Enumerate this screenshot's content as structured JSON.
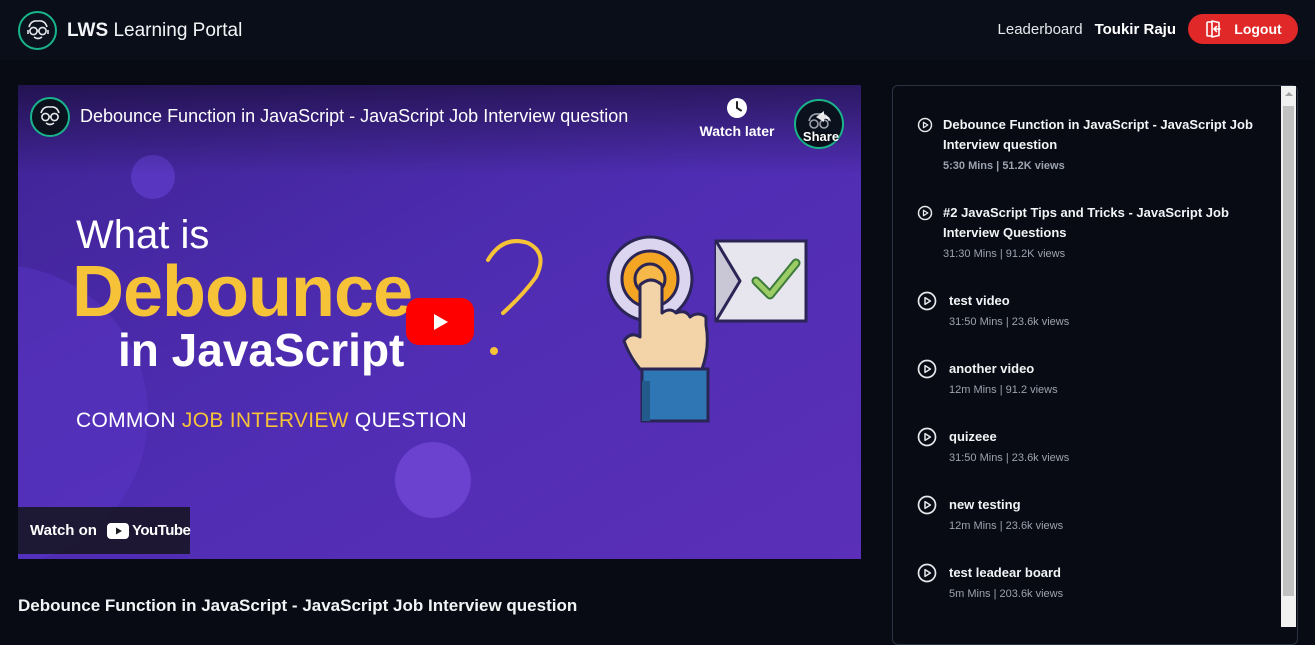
{
  "header": {
    "brand_bold": "LWS",
    "brand_rest": " Learning Portal",
    "nav_leaderboard": "Leaderboard",
    "user_name": "Toukir Raju",
    "logout_label": "Logout"
  },
  "player": {
    "title": "Debounce Function in JavaScript - JavaScript Job Interview question",
    "watch_later_label": "Watch later",
    "share_label": "Share",
    "thumbnail": {
      "line1": "What is",
      "line2": "Debounce",
      "line3": "in JavaScript",
      "line4_a": "COMMON ",
      "line4_b": "JOB INTERVIEW",
      "line4_c": " QUESTION"
    },
    "watch_on_label": "Watch on",
    "youtube_word": "YouTube"
  },
  "video": {
    "title": "Debounce Function in JavaScript - JavaScript Job Interview question"
  },
  "playlist": {
    "items": [
      {
        "title": "Debounce Function in JavaScript - JavaScript Job Interview question",
        "meta": "5:30 Mins | 51.2K views"
      },
      {
        "title": "#2 JavaScript Tips and Tricks - JavaScript Job Interview Questions",
        "meta": "31:30 Mins | 91.2K views"
      },
      {
        "title": "test video",
        "meta": "31:50 Mins | 23.6k views"
      },
      {
        "title": "another video",
        "meta": "12m Mins | 91.2 views"
      },
      {
        "title": "quizeee",
        "meta": "31:50 Mins | 23.6k views"
      },
      {
        "title": "new testing",
        "meta": "12m Mins | 23.6k views"
      },
      {
        "title": "test leadear board",
        "meta": "5m Mins | 203.6k views"
      }
    ]
  },
  "colors": {
    "background": "#080b14",
    "logout": "#e02828",
    "accent_teal": "#19b58a",
    "thumbnail_purple": "#4a2ba8",
    "thumbnail_yellow": "#f6c238"
  },
  "icons": [
    "nerd-face-logo-icon",
    "logout-icon",
    "clock-icon",
    "share-icon",
    "play-icon",
    "youtube-logo-icon",
    "play-circle-icon"
  ]
}
